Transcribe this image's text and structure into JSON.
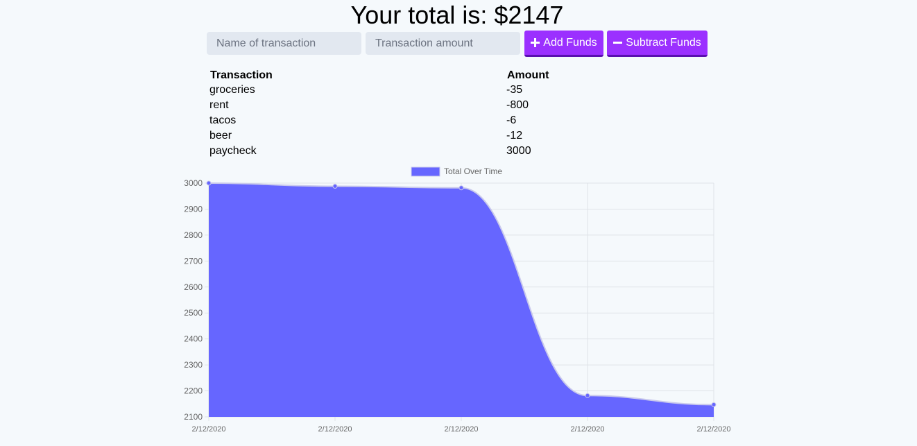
{
  "header": {
    "total_text": "Your total is: $2147"
  },
  "form": {
    "name_placeholder": "Name of transaction",
    "amount_placeholder": "Transaction amount",
    "add_label": "Add Funds",
    "subtract_label": "Subtract Funds"
  },
  "table": {
    "headers": [
      "Transaction",
      "Amount"
    ],
    "rows": [
      [
        "groceries",
        "-35"
      ],
      [
        "rent",
        "-800"
      ],
      [
        "tacos",
        "-6"
      ],
      [
        "beer",
        "-12"
      ],
      [
        "paycheck",
        "3000"
      ]
    ]
  },
  "colors": {
    "accent": "#9b30ff",
    "series_fill": "#6666ff",
    "background": "#f5f9fc"
  },
  "chart_data": {
    "type": "area",
    "legend_label": "Total Over Time",
    "legend_position": "top",
    "categories": [
      "2/12/2020",
      "2/12/2020",
      "2/12/2020",
      "2/12/2020",
      "2/12/2020"
    ],
    "series": [
      {
        "name": "Total Over Time",
        "values": [
          3000,
          2988,
          2982,
          2182,
          2147
        ]
      }
    ],
    "ylim": [
      2100,
      3000
    ],
    "yticks": [
      3000,
      2900,
      2800,
      2700,
      2600,
      2500,
      2400,
      2300,
      2200,
      2100
    ],
    "grid": true
  }
}
